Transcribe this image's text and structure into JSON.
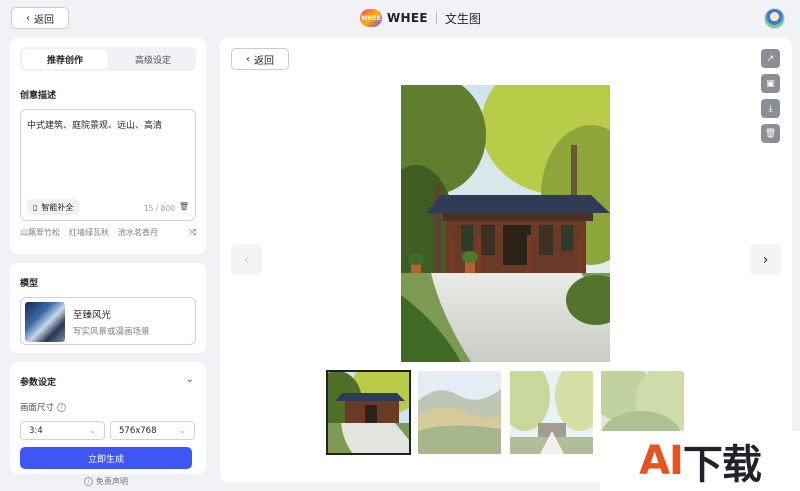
{
  "topbar": {
    "back_label": "返回",
    "logo_text": "WHEE",
    "brand_name": "WHEE",
    "page_title": "文生图"
  },
  "tabs": [
    {
      "label": "推荐创作",
      "active": true
    },
    {
      "label": "高级设定",
      "active": false
    }
  ],
  "prompt": {
    "section_title": "创意描述",
    "value": "中式建筑、庭院景观、远山、高清",
    "smart_complete_label": "智能补全",
    "counter": "15 / 800",
    "suggestions": [
      "山籟翠竹松",
      "红墙绿瓦秋",
      "池水茗香月"
    ]
  },
  "model": {
    "section_title": "模型",
    "name": "至臻风光",
    "description": "写实风景或漫画场景"
  },
  "params": {
    "section_title": "参数设定",
    "size_label": "画面尺寸",
    "ratio_value": "3:4",
    "resolution_value": "576x768"
  },
  "generate_label": "立即生成",
  "disclaimer_label": "免责声明",
  "main": {
    "back_label": "返回",
    "tool_icons": [
      "external-link-icon",
      "image-compare-icon",
      "download-icon",
      "trash-icon"
    ]
  },
  "thumbnails": [
    {
      "name": "thumbnail-1",
      "selected": true
    },
    {
      "name": "thumbnail-2",
      "selected": false
    },
    {
      "name": "thumbnail-3",
      "selected": false
    },
    {
      "name": "thumbnail-4",
      "selected": false
    }
  ],
  "watermark": {
    "a": "AI",
    "rest": "下载"
  },
  "colors": {
    "accent": "#3d56f5",
    "watermark_accent": "#e8531d"
  }
}
